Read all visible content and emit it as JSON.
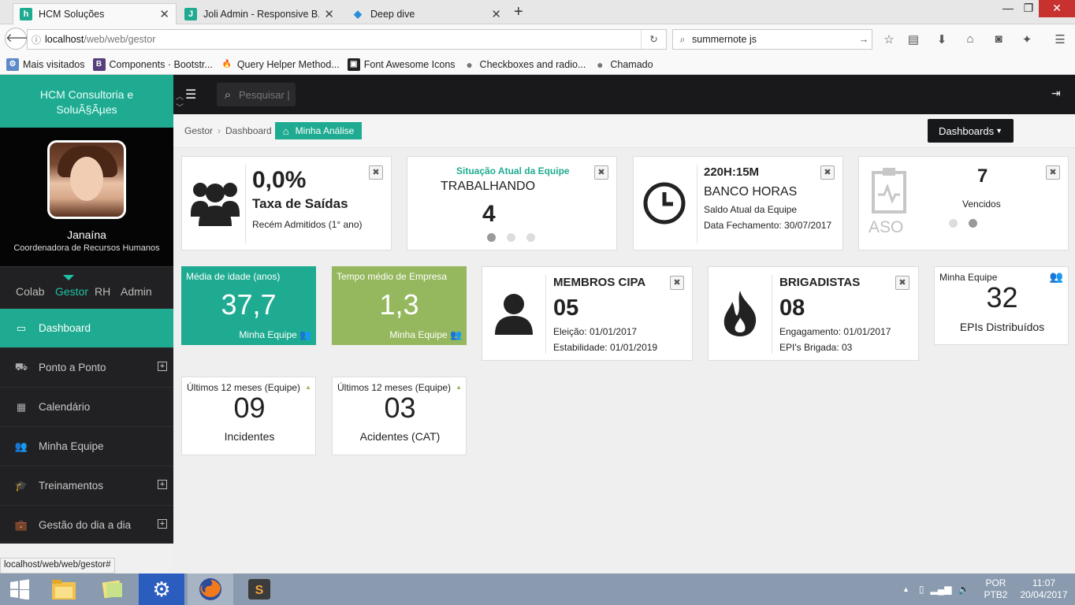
{
  "browser": {
    "tabs": [
      {
        "title": "HCM Soluções",
        "favicon": "h",
        "color": "#1fab91",
        "active": true
      },
      {
        "title": "Joli Admin - Responsive B...",
        "favicon": "J",
        "color": "#1fab91",
        "active": false
      },
      {
        "title": "Deep dive",
        "favicon": "◆",
        "color": "#2a8fd9",
        "active": false
      }
    ],
    "url_host": "localhost",
    "url_path": "/web/web/gestor",
    "search_value": "summernote js",
    "bookmarks": [
      {
        "label": "Mais visitados",
        "icon": "⚙",
        "color": "#5b89c9"
      },
      {
        "label": "Components · Bootstr...",
        "icon": "B",
        "color": "#563d7c"
      },
      {
        "label": "Query Helper Method...",
        "icon": "🔥",
        "color": "#f9f9f9"
      },
      {
        "label": "Font Awesome Icons",
        "icon": "▣",
        "color": "#222"
      },
      {
        "label": "Checkboxes and radio...",
        "icon": "●",
        "color": "#888"
      },
      {
        "label": "Chamado",
        "icon": "●",
        "color": "#888"
      }
    ],
    "status_url": "localhost/web/web/gestor#"
  },
  "sidebar": {
    "brand": "HCM Consultoria e SoluÃ§Ãµes",
    "user_name": "Janaína",
    "user_role": "Coordenadora de Recursos Humanos",
    "roles": [
      "Colab",
      "Gestor",
      "RH",
      "Admin"
    ],
    "active_role": "Gestor",
    "menu": [
      {
        "label": "Dashboard",
        "icon": "desktop-icon",
        "glyph": "▭",
        "expandable": false,
        "active": true
      },
      {
        "label": "Ponto a Ponto",
        "icon": "truck-icon",
        "glyph": "⛟",
        "expandable": true,
        "active": false
      },
      {
        "label": "Calendário",
        "icon": "calendar-icon",
        "glyph": "▦",
        "expandable": false,
        "active": false
      },
      {
        "label": "Minha Equipe",
        "icon": "users-icon",
        "glyph": "👥",
        "expandable": false,
        "active": false
      },
      {
        "label": "Treinamentos",
        "icon": "graduation-cap-icon",
        "glyph": "🎓",
        "expandable": true,
        "active": false
      },
      {
        "label": "Gestão do dia a dia",
        "icon": "briefcase-icon",
        "glyph": "💼",
        "expandable": true,
        "active": false
      }
    ]
  },
  "topbar": {
    "search_placeholder": "Pesquisar |"
  },
  "breadcrumb": {
    "items": [
      "Gestor",
      "Dashboard"
    ],
    "current": "Minha Análise"
  },
  "dashboards_button": "Dashboards",
  "cards": {
    "saidas": {
      "value": "0,0%",
      "title": "Taxa de Saídas",
      "sub": "Recém Admitidos (1° ano)"
    },
    "situacao": {
      "header": "Situação Atual da Equipe",
      "status": "TRABALHANDO",
      "value": "4"
    },
    "banco": {
      "value": "220H:15M",
      "title": "BANCO HORAS",
      "line1": "Saldo Atual da Equipe",
      "line2": "Data Fechamento: 30/07/2017"
    },
    "aso": {
      "icon_label": "ASO",
      "value": "7",
      "label": "Vencidos"
    },
    "idade": {
      "label": "Média de idade (anos)",
      "value": "37,7",
      "footer": "Minha Equipe",
      "color": "#1fab91"
    },
    "tempo": {
      "label": "Tempo médio de Empresa",
      "value": "1,3",
      "footer": "Minha Equipe",
      "color": "#95b75d"
    },
    "cipa": {
      "title": "MEMBROS CIPA",
      "value": "05",
      "line1": "Eleição: 01/01/2017",
      "line2": "Estabilidade: 01/01/2019"
    },
    "brigada": {
      "title": "BRIGADISTAS",
      "value": "08",
      "line1": "Engagamento: 01/01/2017",
      "line2": "EPI's Brigada: 03"
    },
    "epi": {
      "label": "Minha Equipe",
      "value": "32",
      "footer": "EPIs Distribuídos"
    },
    "incidentes": {
      "label": "Últimos 12 meses (Equipe)",
      "value": "09",
      "footer": "Incidentes"
    },
    "acidentes": {
      "label": "Últimos 12 meses (Equipe)",
      "value": "03",
      "footer": "Acidentes (CAT)"
    }
  },
  "taskbar": {
    "lang1": "POR",
    "lang2": "PTB2",
    "time": "11:07",
    "date": "20/04/2017"
  }
}
